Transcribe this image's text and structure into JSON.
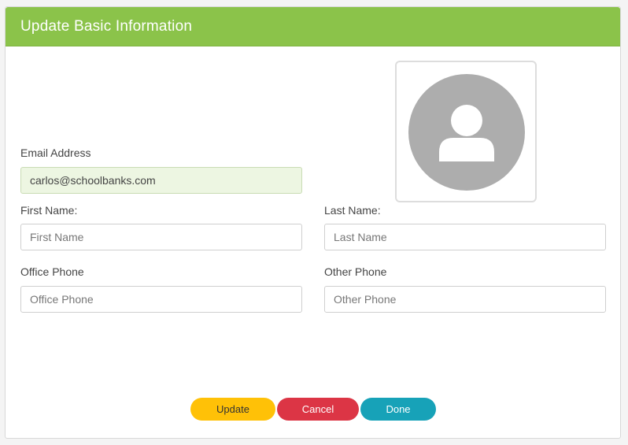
{
  "dialog": {
    "title": "Update Basic Information"
  },
  "avatar": {
    "icon": "user-avatar-placeholder-icon"
  },
  "form": {
    "email": {
      "label": "Email Address",
      "value": "carlos@schoolbanks.com"
    },
    "first_name": {
      "label": "First Name:",
      "placeholder": "First Name",
      "value": ""
    },
    "last_name": {
      "label": "Last Name:",
      "placeholder": "Last Name",
      "value": ""
    },
    "office_phone": {
      "label": "Office Phone",
      "placeholder": "Office Phone",
      "value": ""
    },
    "other_phone": {
      "label": "Other Phone",
      "placeholder": "Other Phone",
      "value": ""
    }
  },
  "buttons": {
    "update": "Update",
    "cancel": "Cancel",
    "done": "Done"
  },
  "colors": {
    "header": "#8bc34a",
    "update": "#ffc107",
    "cancel": "#dc3545",
    "done": "#17a2b8"
  }
}
